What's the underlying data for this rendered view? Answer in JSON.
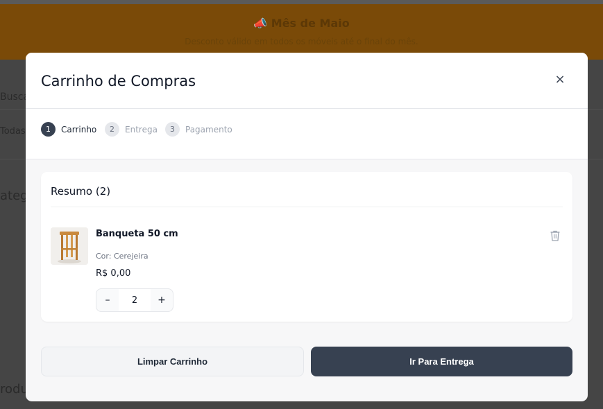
{
  "background": {
    "banner_title": "📣 Mês de Maio",
    "banner_subtitle": "Desconto válido em todos os móveis até o final do mês.",
    "search_fragment": "Busca",
    "select_fragment": "Todas a",
    "categories_fragment": "atego",
    "products_fragment": "rodut"
  },
  "modal": {
    "title": "Carrinho de Compras",
    "close_icon": "×",
    "steps": [
      {
        "number": "1",
        "label": "Carrinho",
        "active": true
      },
      {
        "number": "2",
        "label": "Entrega",
        "active": false
      },
      {
        "number": "3",
        "label": "Pagamento",
        "active": false
      }
    ],
    "summary": {
      "title": "Resumo (2)",
      "item": {
        "name": "Banqueta 50 cm",
        "color": "Cor: Cerejeira",
        "price": "R$ 0,00",
        "quantity": "2",
        "decrement": "–",
        "increment": "+"
      }
    },
    "buttons": {
      "clear": "Limpar Carrinho",
      "next": "Ir Para Entrega"
    }
  },
  "colors": {
    "primary": "#374151",
    "backdrop": "#4a4a4a",
    "banner": "#7a4a08"
  }
}
